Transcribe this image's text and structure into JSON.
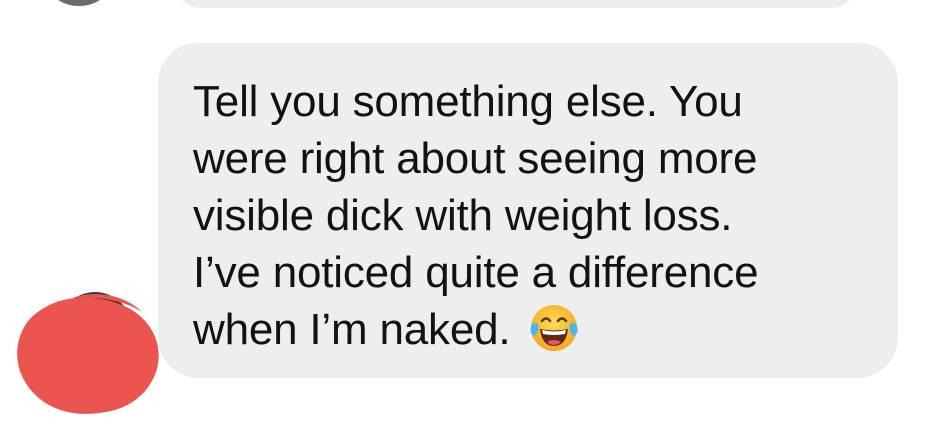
{
  "conversation": {
    "message": {
      "lines": [
        "Tell you something else. You",
        "were right about seeing more",
        "visible dick with weight loss.",
        "I’ve noticed quite a difference",
        "when I’m naked."
      ],
      "trailing_emoji": "face-with-tears-of-joy-icon"
    },
    "avatar": {
      "censor_color": "#ec544f"
    }
  }
}
